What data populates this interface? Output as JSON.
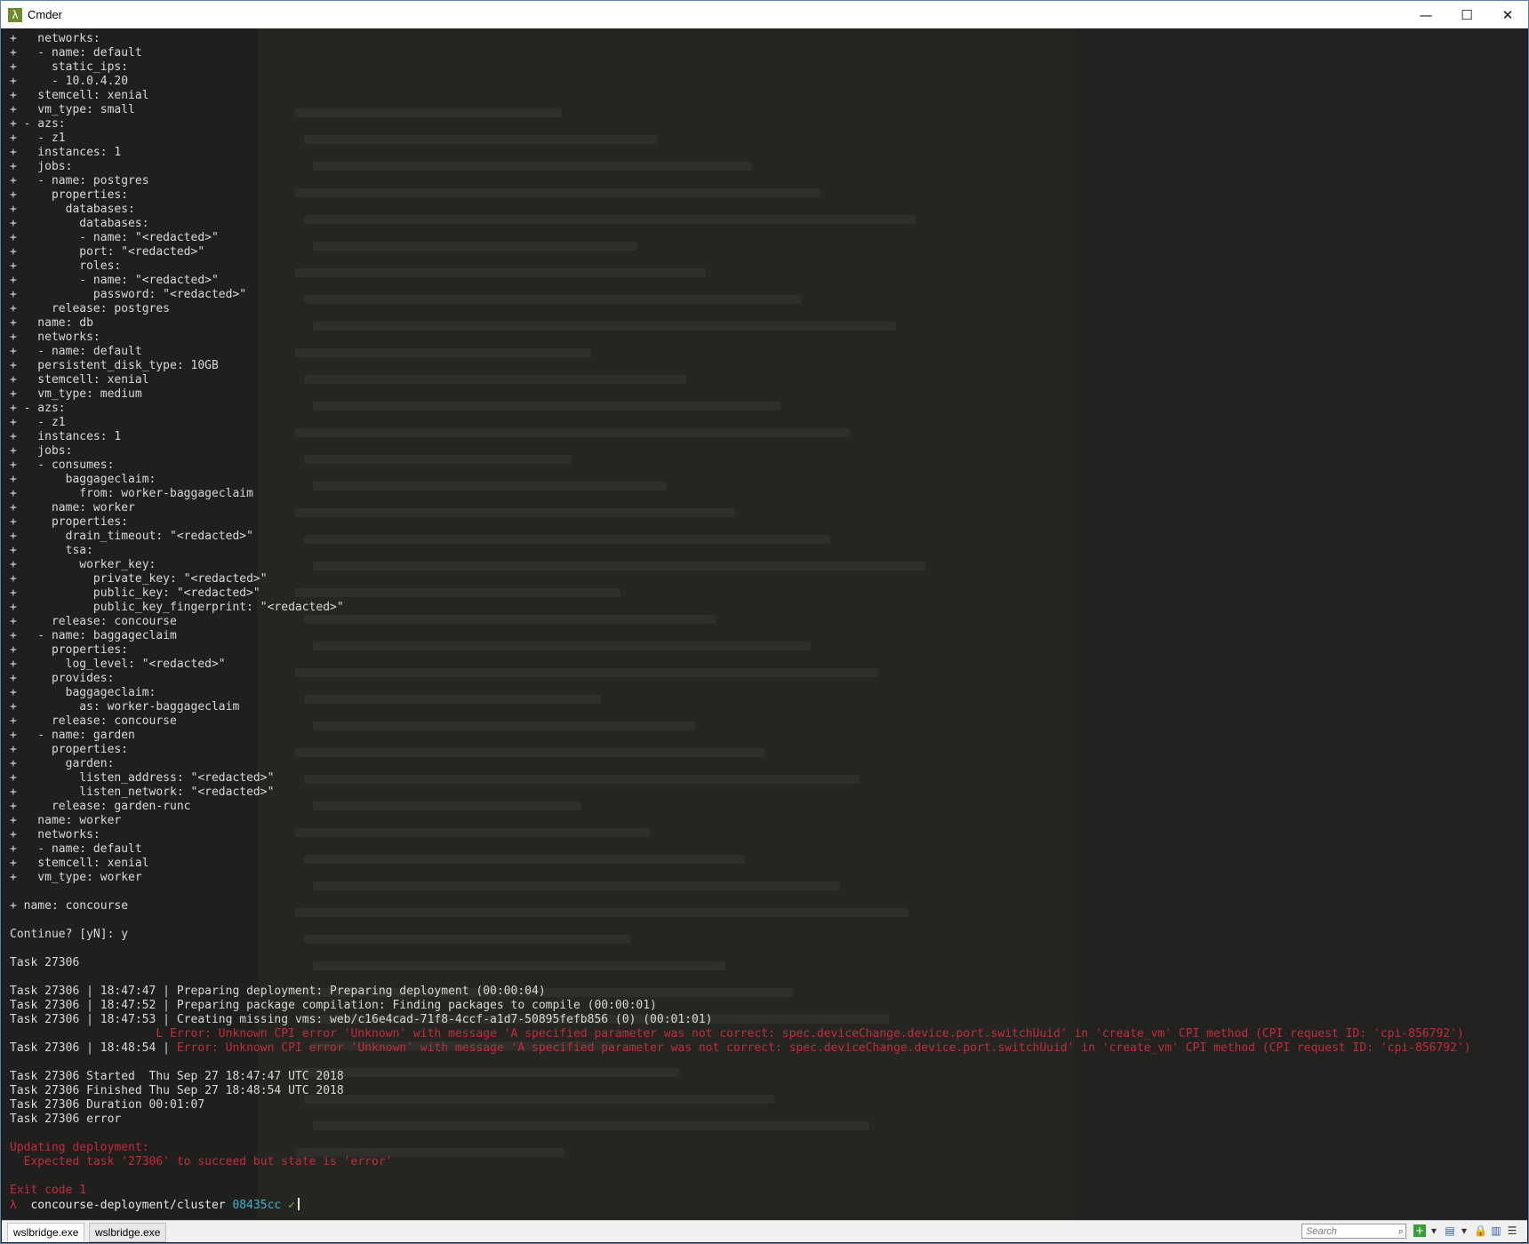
{
  "window": {
    "title": "Cmder",
    "app_icon": "λ",
    "minimize_icon": "—",
    "maximize_icon": "☐",
    "close_icon": "✕"
  },
  "terminal": {
    "lines": [
      {
        "text": "+   networks:"
      },
      {
        "text": "+   - name: default"
      },
      {
        "text": "+     static_ips:"
      },
      {
        "text": "+     - 10.0.4.20"
      },
      {
        "text": "+   stemcell: xenial"
      },
      {
        "text": "+   vm_type: small"
      },
      {
        "text": "+ - azs:"
      },
      {
        "text": "+   - z1"
      },
      {
        "text": "+   instances: 1"
      },
      {
        "text": "+   jobs:"
      },
      {
        "text": "+   - name: postgres"
      },
      {
        "text": "+     properties:"
      },
      {
        "text": "+       databases:"
      },
      {
        "text": "+         databases:"
      },
      {
        "text": "+         - name: \"<redacted>\""
      },
      {
        "text": "+         port: \"<redacted>\""
      },
      {
        "text": "+         roles:"
      },
      {
        "text": "+         - name: \"<redacted>\""
      },
      {
        "text": "+           password: \"<redacted>\""
      },
      {
        "text": "+     release: postgres"
      },
      {
        "text": "+   name: db"
      },
      {
        "text": "+   networks:"
      },
      {
        "text": "+   - name: default"
      },
      {
        "text": "+   persistent_disk_type: 10GB"
      },
      {
        "text": "+   stemcell: xenial"
      },
      {
        "text": "+   vm_type: medium"
      },
      {
        "text": "+ - azs:"
      },
      {
        "text": "+   - z1"
      },
      {
        "text": "+   instances: 1"
      },
      {
        "text": "+   jobs:"
      },
      {
        "text": "+   - consumes:"
      },
      {
        "text": "+       baggageclaim:"
      },
      {
        "text": "+         from: worker-baggageclaim"
      },
      {
        "text": "+     name: worker"
      },
      {
        "text": "+     properties:"
      },
      {
        "text": "+       drain_timeout: \"<redacted>\""
      },
      {
        "text": "+       tsa:"
      },
      {
        "text": "+         worker_key:"
      },
      {
        "text": "+           private_key: \"<redacted>\""
      },
      {
        "text": "+           public_key: \"<redacted>\""
      },
      {
        "text": "+           public_key_fingerprint: \"<redacted>\""
      },
      {
        "text": "+     release: concourse"
      },
      {
        "text": "+   - name: baggageclaim"
      },
      {
        "text": "+     properties:"
      },
      {
        "text": "+       log_level: \"<redacted>\""
      },
      {
        "text": "+     provides:"
      },
      {
        "text": "+       baggageclaim:"
      },
      {
        "text": "+         as: worker-baggageclaim"
      },
      {
        "text": "+     release: concourse"
      },
      {
        "text": "+   - name: garden"
      },
      {
        "text": "+     properties:"
      },
      {
        "text": "+       garden:"
      },
      {
        "text": "+         listen_address: \"<redacted>\""
      },
      {
        "text": "+         listen_network: \"<redacted>\""
      },
      {
        "text": "+     release: garden-runc"
      },
      {
        "text": "+   name: worker"
      },
      {
        "text": "+   networks:"
      },
      {
        "text": "+   - name: default"
      },
      {
        "text": "+   stemcell: xenial"
      },
      {
        "text": "+   vm_type: worker"
      },
      {
        "text": ""
      },
      {
        "text": "+ name: concourse"
      },
      {
        "text": ""
      },
      {
        "text": "Continue? [yN]: y"
      },
      {
        "text": ""
      },
      {
        "text": "Task 27306"
      },
      {
        "text": ""
      },
      {
        "text": "Task 27306 | 18:47:47 | Preparing deployment: Preparing deployment (00:00:04)"
      },
      {
        "text": "Task 27306 | 18:47:52 | Preparing package compilation: Finding packages to compile (00:00:01)"
      },
      {
        "text": "Task 27306 | 18:47:53 | Creating missing vms: web/c16e4cad-71f8-4ccf-a1d7-50895fefb856 (0) (00:01:01)"
      },
      {
        "text": "                     L Error: Unknown CPI error 'Unknown' with message 'A specified parameter was not correct: spec.deviceChange.device.port.switchUuid' in 'create_vm' CPI method (CPI request ID: 'cpi-856792')",
        "error": true
      },
      {
        "text": "Task 27306 | 18:48:54 | ",
        "suffix": "Error: Unknown CPI error 'Unknown' with message 'A specified parameter was not correct: spec.deviceChange.device.port.switchUuid' in 'create_vm' CPI method (CPI request ID: 'cpi-856792')"
      },
      {
        "text": ""
      },
      {
        "text": "Task 27306 Started  Thu Sep 27 18:47:47 UTC 2018"
      },
      {
        "text": "Task 27306 Finished Thu Sep 27 18:48:54 UTC 2018"
      },
      {
        "text": "Task 27306 Duration 00:01:07"
      },
      {
        "text": "Task 27306 error"
      },
      {
        "text": ""
      },
      {
        "text": "Updating deployment:",
        "error": true
      },
      {
        "text": "  Expected task '27306' to succeed but state is 'error'",
        "error": true
      },
      {
        "text": ""
      },
      {
        "text": "Exit code 1",
        "error": true
      }
    ],
    "prompt": {
      "lambda": "λ",
      "path": "concourse-deployment/cluster",
      "git_hash": "08435cc",
      "status": "✓"
    }
  },
  "statusbar": {
    "tabs": [
      {
        "label": "wslbridge.exe",
        "active": true
      },
      {
        "label": "wslbridge.exe",
        "active": false
      }
    ],
    "search_placeholder": "Search",
    "search_icon": "⌕",
    "new_console_icon": "+",
    "dropdown_icon": "▾",
    "layout_icon": "▤",
    "lock_icon": "🔒",
    "panel_icon": "▥",
    "settings_icon": "☰"
  },
  "colors": {
    "background": "#262723",
    "text": "#d8d8d8",
    "error": "#c8283c",
    "git_hash": "#3fb3d0",
    "check": "#6bbf3a"
  }
}
